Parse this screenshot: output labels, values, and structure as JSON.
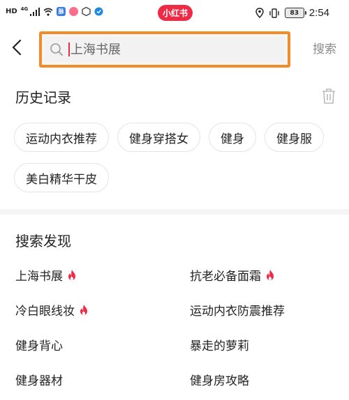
{
  "status_bar": {
    "hd": "HD",
    "network": "4G",
    "brand": "小红书",
    "battery": "83",
    "time": "2:54",
    "app_chip_label": "脉"
  },
  "search": {
    "placeholder": "上海书展",
    "submit_label": "搜索"
  },
  "history": {
    "title": "历史记录",
    "items": [
      {
        "label": "运动内衣推荐"
      },
      {
        "label": "健身穿搭女"
      },
      {
        "label": "健身"
      },
      {
        "label": "健身服"
      },
      {
        "label": "美白精华干皮"
      }
    ]
  },
  "discover": {
    "title": "搜索发现",
    "items": [
      {
        "label": "上海书展",
        "hot": true
      },
      {
        "label": "抗老必备面霜",
        "hot": true
      },
      {
        "label": "冷白眼线妆",
        "hot": true
      },
      {
        "label": "运动内衣防震推荐",
        "hot": false
      },
      {
        "label": "健身背心",
        "hot": false
      },
      {
        "label": "暴走的萝莉",
        "hot": false
      },
      {
        "label": "健身器材",
        "hot": false
      },
      {
        "label": "健身房攻略",
        "hot": false
      }
    ]
  },
  "colors": {
    "brand": "#ee2b47",
    "highlight_border": "#f08c2a",
    "hot_icon": "#ee2b47"
  },
  "icons": {
    "back": "chevron-left-icon",
    "search": "search-icon",
    "trash": "trash-icon",
    "hot": "fire-icon"
  }
}
